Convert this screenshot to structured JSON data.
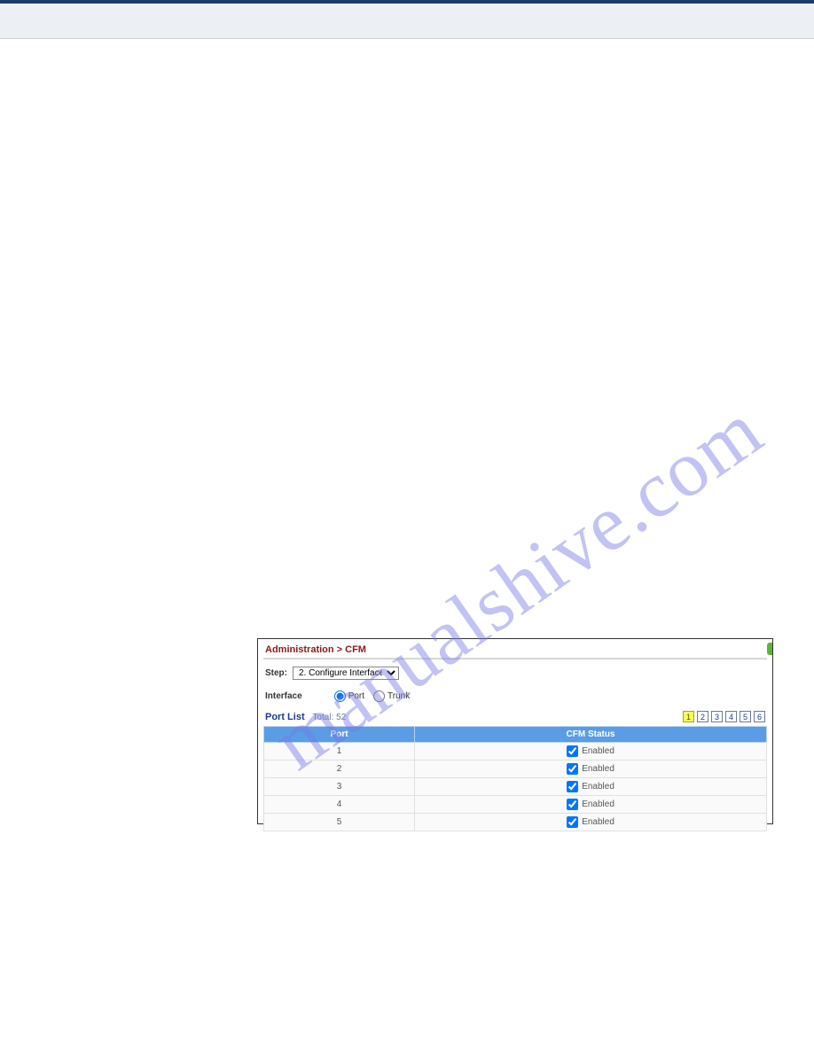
{
  "watermark": "manualshive.com",
  "figure": {
    "title": "Administration > CFM",
    "step_label": "Step:",
    "step_value": "2. Configure Interface",
    "interface_label": "Interface",
    "radio_port": "Port",
    "radio_trunk": "Trunk",
    "portlist_label": "Port List",
    "portlist_total": "Total: 52",
    "pager": [
      "1",
      "2",
      "3",
      "4",
      "5",
      "6"
    ],
    "pager_active": 0,
    "headers": {
      "port": "Port",
      "status": "CFM Status"
    },
    "rows": [
      {
        "port": "1",
        "status": "Enabled",
        "checked": true
      },
      {
        "port": "2",
        "status": "Enabled",
        "checked": true
      },
      {
        "port": "3",
        "status": "Enabled",
        "checked": true
      },
      {
        "port": "4",
        "status": "Enabled",
        "checked": true
      },
      {
        "port": "5",
        "status": "Enabled",
        "checked": true
      }
    ]
  }
}
